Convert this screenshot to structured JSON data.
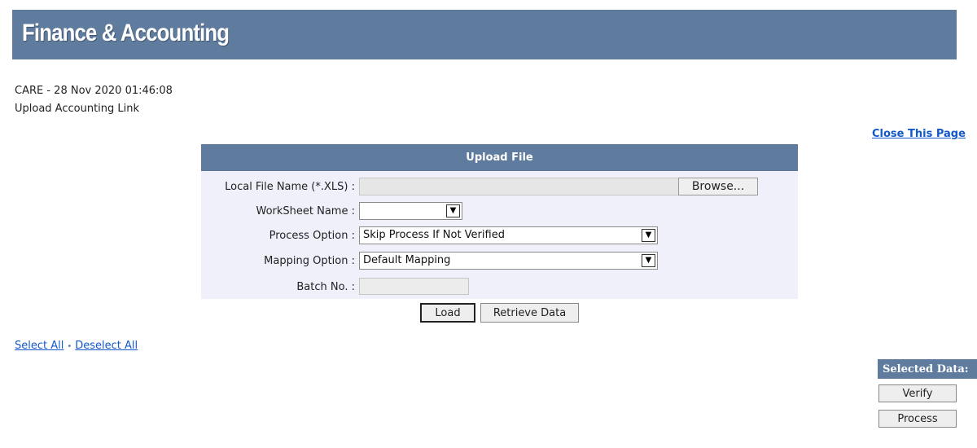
{
  "header": {
    "title": "Finance & Accounting"
  },
  "info": {
    "line1": "CARE - 28 Nov 2020 01:46:08",
    "line2": "Upload Accounting Link"
  },
  "close_link": "Close This Page",
  "upload": {
    "title": "Upload File",
    "file_label": "Local File Name (*.XLS) :",
    "file_value": "",
    "browse_label": "Browse...",
    "worksheet_label": "WorkSheet Name :",
    "worksheet_value": "",
    "process_label": "Process Option :",
    "process_value": "Skip Process If Not Verified",
    "mapping_label": "Mapping Option :",
    "mapping_value": "Default Mapping",
    "batch_label": "Batch No. :",
    "batch_value": ""
  },
  "actions": {
    "load": "Load",
    "retrieve": "Retrieve Data"
  },
  "selection": {
    "select_all": "Select All",
    "separator": "•",
    "deselect_all": "Deselect All"
  },
  "selected_panel": {
    "title": "Selected Data:",
    "verify": "Verify",
    "process": "Process"
  },
  "colors": {
    "banner": "#5f7c9e",
    "panel_bg": "#f0f0fb",
    "link": "#1358c9"
  }
}
